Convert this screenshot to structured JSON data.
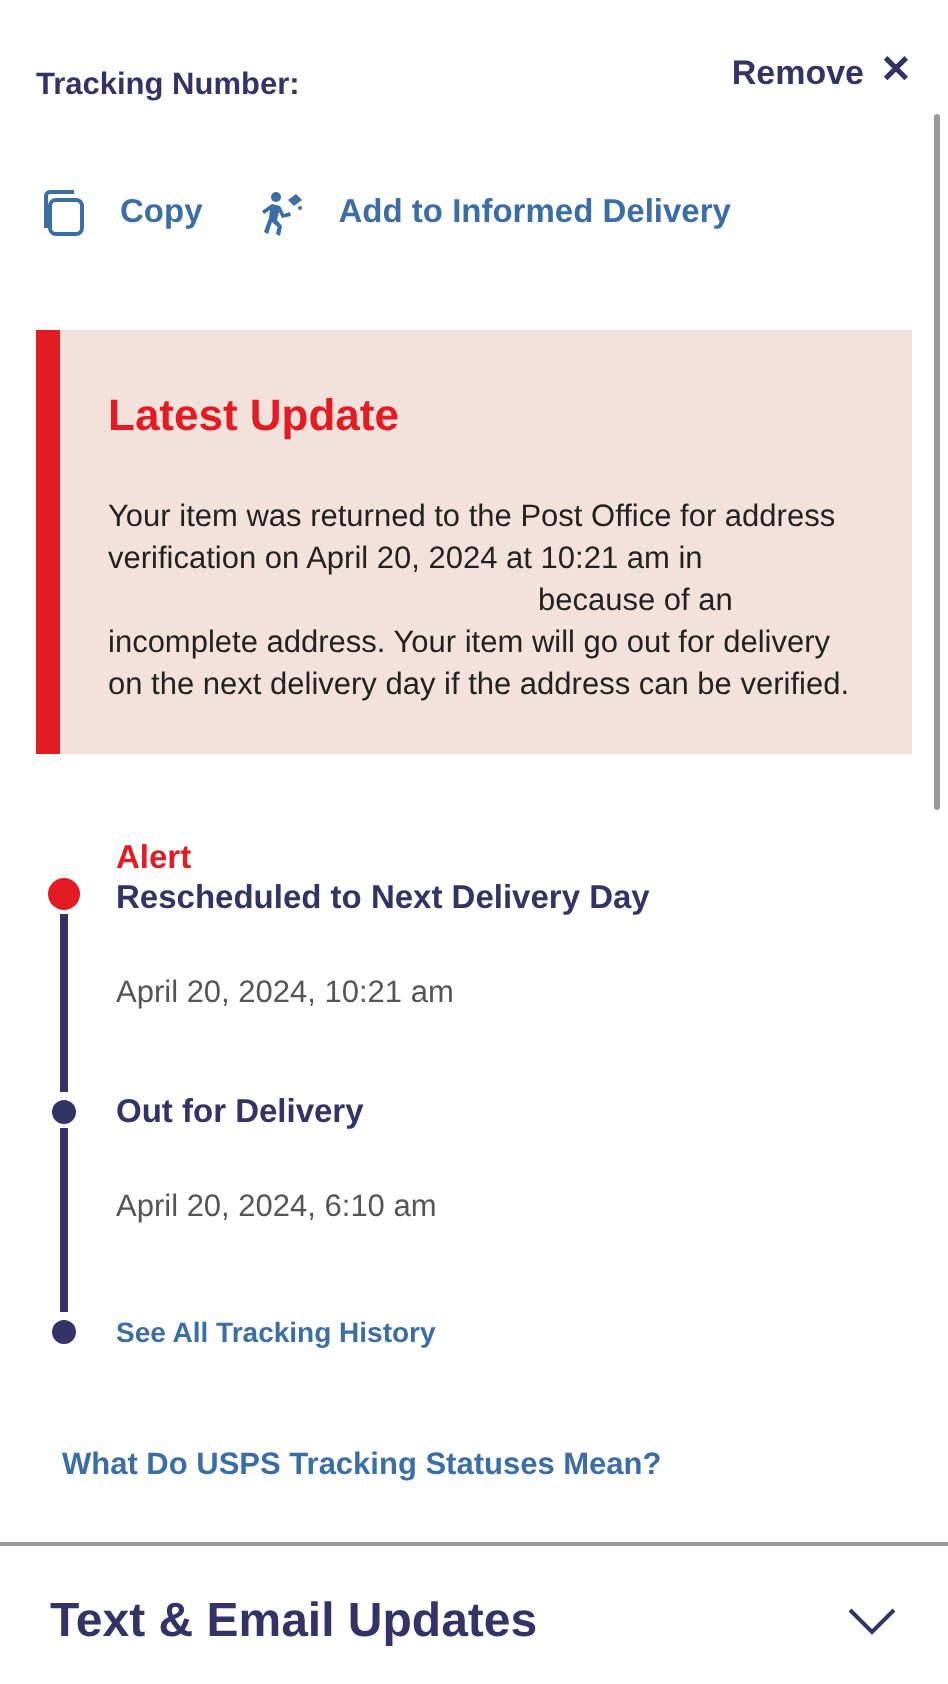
{
  "header": {
    "tracking_label": "Tracking Number:",
    "remove": "Remove",
    "close_glyph": "✕"
  },
  "actions": [
    {
      "kind": "copy",
      "label": "Copy"
    },
    {
      "kind": "informed",
      "label": "Add to Informed Delivery"
    }
  ],
  "latest_update": {
    "title": "Latest Update",
    "body_before_gap": "Your item was returned to the Post Office for address verification on April 20, 2024 at 10:21 am in",
    "body_after_gap": "because of an incomplete address. Your item will go out for delivery on the next delivery day if the address can be verified."
  },
  "events": [
    {
      "kind": "alert",
      "label": "Alert",
      "status": "Rescheduled to Next Delivery Day",
      "date": "April 20, 2024, 10:21 am"
    },
    {
      "kind": "normal",
      "status": "Out for Delivery",
      "date": "April 20, 2024, 6:10 am"
    }
  ],
  "history_link": "See All Tracking History",
  "statuses_link": "What Do USPS Tracking Statuses Mean?",
  "section": {
    "title": "Text & Email Updates",
    "expanded": false
  }
}
